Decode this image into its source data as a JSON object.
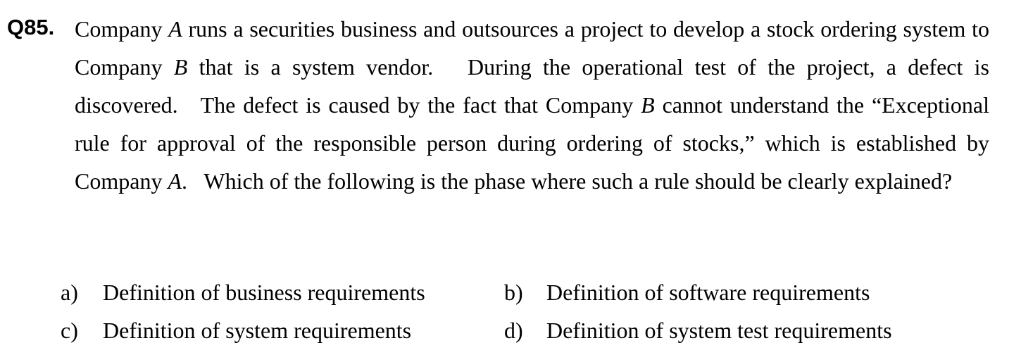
{
  "question": {
    "number": "Q85.",
    "segments": [
      {
        "text": "Company ",
        "italic": false
      },
      {
        "text": "A",
        "italic": true
      },
      {
        "text": " runs a securities business and outsources a project to develop a stock ordering system to Company ",
        "italic": false
      },
      {
        "text": "B",
        "italic": true
      },
      {
        "text": " that is a system vendor.   During the operational test of the project, a defect is discovered.   The defect is caused by the fact that Company ",
        "italic": false
      },
      {
        "text": "B",
        "italic": true
      },
      {
        "text": " cannot understand the “Exceptional rule for approval of the responsible person during ordering of stocks,” which is established by Company ",
        "italic": false
      },
      {
        "text": "A",
        "italic": true
      },
      {
        "text": ".   Which of the following is the phase where such a rule should be clearly explained?",
        "italic": false
      }
    ]
  },
  "options": [
    {
      "letter": "a)",
      "text": "Definition of business requirements"
    },
    {
      "letter": "b)",
      "text": "Definition of software requirements"
    },
    {
      "letter": "c)",
      "text": "Definition of system requirements"
    },
    {
      "letter": "d)",
      "text": "Definition of system test requirements"
    }
  ]
}
